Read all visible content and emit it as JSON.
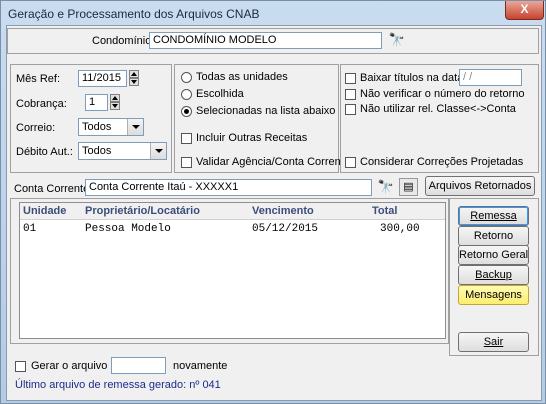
{
  "window": {
    "title": "Geração e Processamento dos Arquivos CNAB",
    "close_glyph": "X"
  },
  "condominio": {
    "label": "Condomínio:",
    "value": "CONDOMÍNIO MODELO"
  },
  "mes_ref": {
    "label": "Mês Ref:",
    "value": "11/2015"
  },
  "cobranca": {
    "label": "Cobrança:",
    "value": "1"
  },
  "correio": {
    "label": "Correio:",
    "value": "Todos"
  },
  "debito_aut": {
    "label": "Débito Aut.:",
    "value": "Todos"
  },
  "unidades": {
    "todas": "Todas as unidades",
    "escolhida": "Escolhida",
    "selecionadas": "Selecionadas na lista abaixo",
    "selected": "selecionadas"
  },
  "incluir_outras": "Incluir Outras Receitas",
  "validar_agencia": "Validar Agência/Conta Corrente",
  "baixar_titulos": {
    "label": "Baixar títulos na data:",
    "value": " / /"
  },
  "nao_verificar": "Não verificar o número do retorno",
  "nao_utilizar": "Não utilizar rel. Classe<->Conta",
  "considerar": "Considerar Correções Projetadas",
  "conta_corrente": {
    "label": "Conta Corrente:",
    "value": "Conta Corrente Itaú - XXXXX1"
  },
  "arquivos_retornados": "Arquivos Retornados",
  "table": {
    "headers": [
      "Unidade",
      "Proprietário/Locatário",
      "Vencimento",
      "Total"
    ],
    "rows": [
      [
        "01",
        "Pessoa Modelo",
        "05/12/2015",
        "300,00"
      ]
    ]
  },
  "buttons": {
    "remessa": "Remessa",
    "retorno": "Retorno",
    "retorno_geral": "Retorno Geral",
    "backup": "Backup",
    "mensagens": "Mensagens",
    "sair": "Sair"
  },
  "gerar": {
    "label": "Gerar o arquivo",
    "value": "",
    "suffix": "novamente"
  },
  "ultimo_arquivo": "Último arquivo de remessa gerado: nº 041",
  "colors": {
    "accent": "#fbee70",
    "status_text": "#1b2b8c"
  },
  "icons": [
    "binoculars-icon",
    "binoculars-icon",
    "register-icon",
    "spin-up-icon",
    "spin-down-icon",
    "dropdown-icon"
  ]
}
